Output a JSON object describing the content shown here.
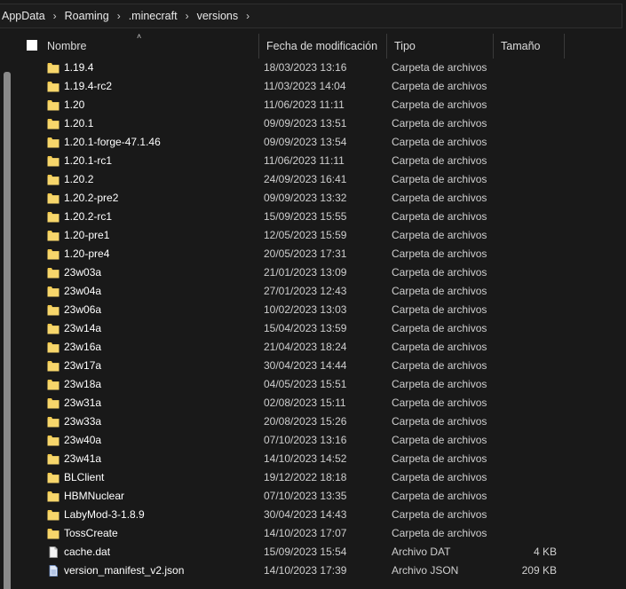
{
  "breadcrumb": [
    "AppData",
    "Roaming",
    ".minecraft",
    "versions"
  ],
  "columns": {
    "name": "Nombre",
    "date": "Fecha de modificación",
    "type": "Tipo",
    "size": "Tamaño"
  },
  "files": [
    {
      "name": "1.19.4",
      "date": "18/03/2023 13:16",
      "type": "Carpeta de archivos",
      "size": "",
      "icon": "folder-icon"
    },
    {
      "name": "1.19.4-rc2",
      "date": "11/03/2023 14:04",
      "type": "Carpeta de archivos",
      "size": "",
      "icon": "folder-icon"
    },
    {
      "name": "1.20",
      "date": "11/06/2023 11:11",
      "type": "Carpeta de archivos",
      "size": "",
      "icon": "folder-icon"
    },
    {
      "name": "1.20.1",
      "date": "09/09/2023 13:51",
      "type": "Carpeta de archivos",
      "size": "",
      "icon": "folder-icon"
    },
    {
      "name": "1.20.1-forge-47.1.46",
      "date": "09/09/2023 13:54",
      "type": "Carpeta de archivos",
      "size": "",
      "icon": "folder-icon"
    },
    {
      "name": "1.20.1-rc1",
      "date": "11/06/2023 11:11",
      "type": "Carpeta de archivos",
      "size": "",
      "icon": "folder-icon"
    },
    {
      "name": "1.20.2",
      "date": "24/09/2023 16:41",
      "type": "Carpeta de archivos",
      "size": "",
      "icon": "folder-icon"
    },
    {
      "name": "1.20.2-pre2",
      "date": "09/09/2023 13:32",
      "type": "Carpeta de archivos",
      "size": "",
      "icon": "folder-icon"
    },
    {
      "name": "1.20.2-rc1",
      "date": "15/09/2023 15:55",
      "type": "Carpeta de archivos",
      "size": "",
      "icon": "folder-icon"
    },
    {
      "name": "1.20-pre1",
      "date": "12/05/2023 15:59",
      "type": "Carpeta de archivos",
      "size": "",
      "icon": "folder-icon"
    },
    {
      "name": "1.20-pre4",
      "date": "20/05/2023 17:31",
      "type": "Carpeta de archivos",
      "size": "",
      "icon": "folder-icon"
    },
    {
      "name": "23w03a",
      "date": "21/01/2023 13:09",
      "type": "Carpeta de archivos",
      "size": "",
      "icon": "folder-icon"
    },
    {
      "name": "23w04a",
      "date": "27/01/2023 12:43",
      "type": "Carpeta de archivos",
      "size": "",
      "icon": "folder-icon"
    },
    {
      "name": "23w06a",
      "date": "10/02/2023 13:03",
      "type": "Carpeta de archivos",
      "size": "",
      "icon": "folder-icon"
    },
    {
      "name": "23w14a",
      "date": "15/04/2023 13:59",
      "type": "Carpeta de archivos",
      "size": "",
      "icon": "folder-icon"
    },
    {
      "name": "23w16a",
      "date": "21/04/2023 18:24",
      "type": "Carpeta de archivos",
      "size": "",
      "icon": "folder-icon"
    },
    {
      "name": "23w17a",
      "date": "30/04/2023 14:44",
      "type": "Carpeta de archivos",
      "size": "",
      "icon": "folder-icon"
    },
    {
      "name": "23w18a",
      "date": "04/05/2023 15:51",
      "type": "Carpeta de archivos",
      "size": "",
      "icon": "folder-icon"
    },
    {
      "name": "23w31a",
      "date": "02/08/2023 15:11",
      "type": "Carpeta de archivos",
      "size": "",
      "icon": "folder-icon"
    },
    {
      "name": "23w33a",
      "date": "20/08/2023 15:26",
      "type": "Carpeta de archivos",
      "size": "",
      "icon": "folder-icon"
    },
    {
      "name": "23w40a",
      "date": "07/10/2023 13:16",
      "type": "Carpeta de archivos",
      "size": "",
      "icon": "folder-icon"
    },
    {
      "name": "23w41a",
      "date": "14/10/2023 14:52",
      "type": "Carpeta de archivos",
      "size": "",
      "icon": "folder-icon"
    },
    {
      "name": "BLClient",
      "date": "19/12/2022 18:18",
      "type": "Carpeta de archivos",
      "size": "",
      "icon": "folder-icon"
    },
    {
      "name": "HBMNuclear",
      "date": "07/10/2023 13:35",
      "type": "Carpeta de archivos",
      "size": "",
      "icon": "folder-icon"
    },
    {
      "name": "LabyMod-3-1.8.9",
      "date": "30/04/2023 14:43",
      "type": "Carpeta de archivos",
      "size": "",
      "icon": "folder-icon"
    },
    {
      "name": "TossCreate",
      "date": "14/10/2023 17:07",
      "type": "Carpeta de archivos",
      "size": "",
      "icon": "folder-icon"
    },
    {
      "name": "cache.dat",
      "date": "15/09/2023 15:54",
      "type": "Archivo DAT",
      "size": "4 KB",
      "icon": "file-icon"
    },
    {
      "name": "version_manifest_v2.json",
      "date": "14/10/2023 17:39",
      "type": "Archivo JSON",
      "size": "209 KB",
      "icon": "json-file-icon"
    }
  ],
  "colors": {
    "background": "#191919",
    "folder": "#f2c94c",
    "text": "#ffffff",
    "muted": "#cfcfcf"
  }
}
